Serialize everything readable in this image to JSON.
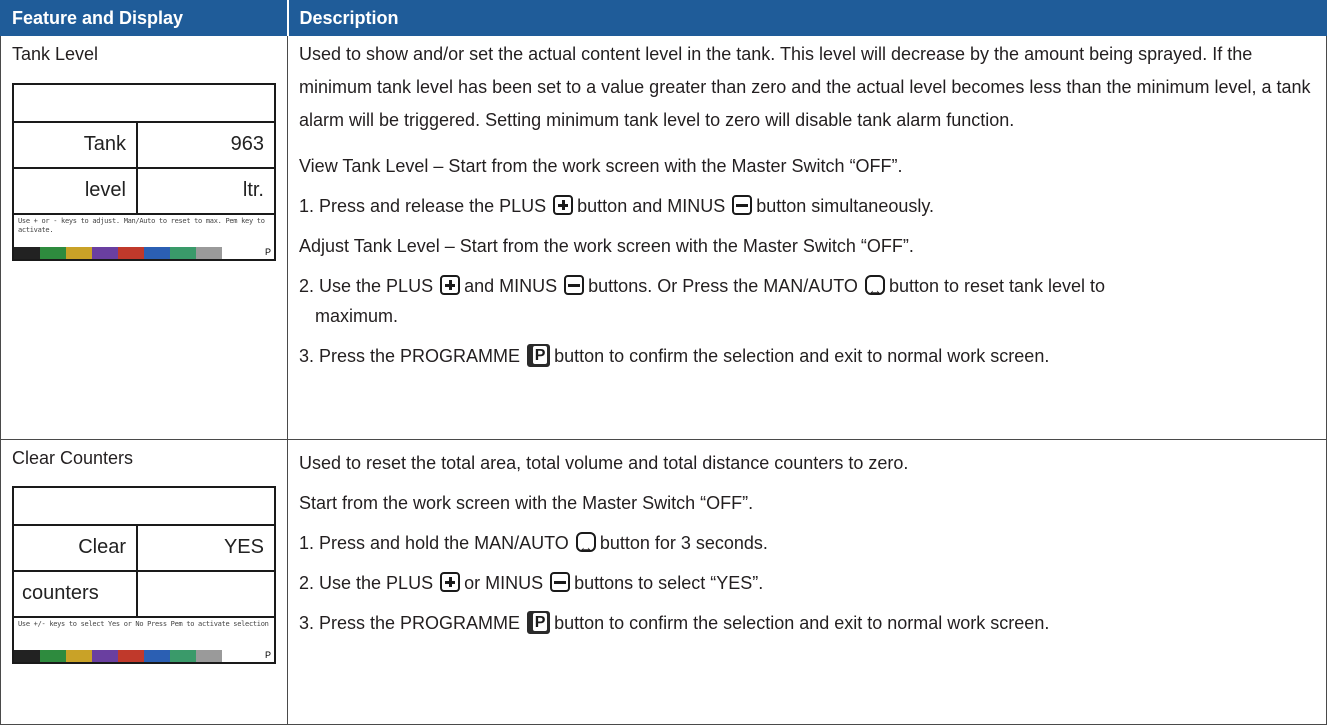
{
  "header": {
    "col1": "Feature and Display",
    "col2": "Description"
  },
  "rows": [
    {
      "feature": "Tank Level",
      "screen": {
        "label1": "Tank",
        "value1": "963",
        "label2": "level",
        "value2": "ltr.",
        "message": "Use + or - keys to adjust. Man/Auto to reset to max. Pem key to activate.",
        "indicator": "P"
      },
      "description": {
        "intro": "Used to show and/or set the actual content level in the tank. This level will decrease by the amount being sprayed. If the minimum tank level has been set to a value greater than zero and the actual level becomes less than the minimum level, a tank alarm will be triggered. Setting minimum tank level to zero will disable tank alarm function.",
        "view_heading": "View Tank Level – Start from the work screen with the Master Switch “OFF”.",
        "step1_a": "1. Press and release the PLUS",
        "step1_b": "button and MINUS",
        "step1_c": "button simultaneously.",
        "adjust_heading": "Adjust Tank Level – Start from the work screen with the Master Switch “OFF”.",
        "step2_a": "2. Use the PLUS",
        "step2_b": "and MINUS",
        "step2_c": "buttons. Or Press the MAN/AUTO",
        "step2_d": "button to reset tank level to",
        "step2_e": "maximum.",
        "step3_a": "3. Press the PROGRAMME",
        "step3_b": "button to confirm the selection and exit to normal work screen."
      }
    },
    {
      "feature": "Clear Counters",
      "screen": {
        "label1": "Clear",
        "value1": "YES",
        "label2": "counters",
        "value2": "",
        "message": "Use +/- keys to select Yes or No Press Pem to activate selection",
        "indicator": "P"
      },
      "description": {
        "intro": "Used to reset the total area, total volume and total distance counters to zero.",
        "start": "Start from the work screen with the Master Switch “OFF”.",
        "step1_a": "1. Press and hold the MAN/AUTO",
        "step1_b": "button for 3 seconds.",
        "step2_a": "2. Use the PLUS",
        "step2_b": "or MINUS",
        "step2_c": "buttons to select “YES”.",
        "step3_a": "3. Press the PROGRAMME",
        "step3_b": "button to confirm the selection and exit to normal work screen."
      }
    }
  ],
  "icons": [
    "plus-icon",
    "minus-icon",
    "man-auto-icon",
    "programme-icon"
  ],
  "colors": {
    "header_bg": "#1f5c99",
    "header_text": "#ffffff",
    "border": "#4a4a4a",
    "text": "#231f20"
  },
  "screen_color_bar": [
    "#222222",
    "#2e8b3e",
    "#c9a227",
    "#6a3fa0",
    "#c0392b",
    "#2b5fb3",
    "#3a9a6a",
    "#9a9a9a",
    "#ffffff",
    "#ffffff"
  ]
}
